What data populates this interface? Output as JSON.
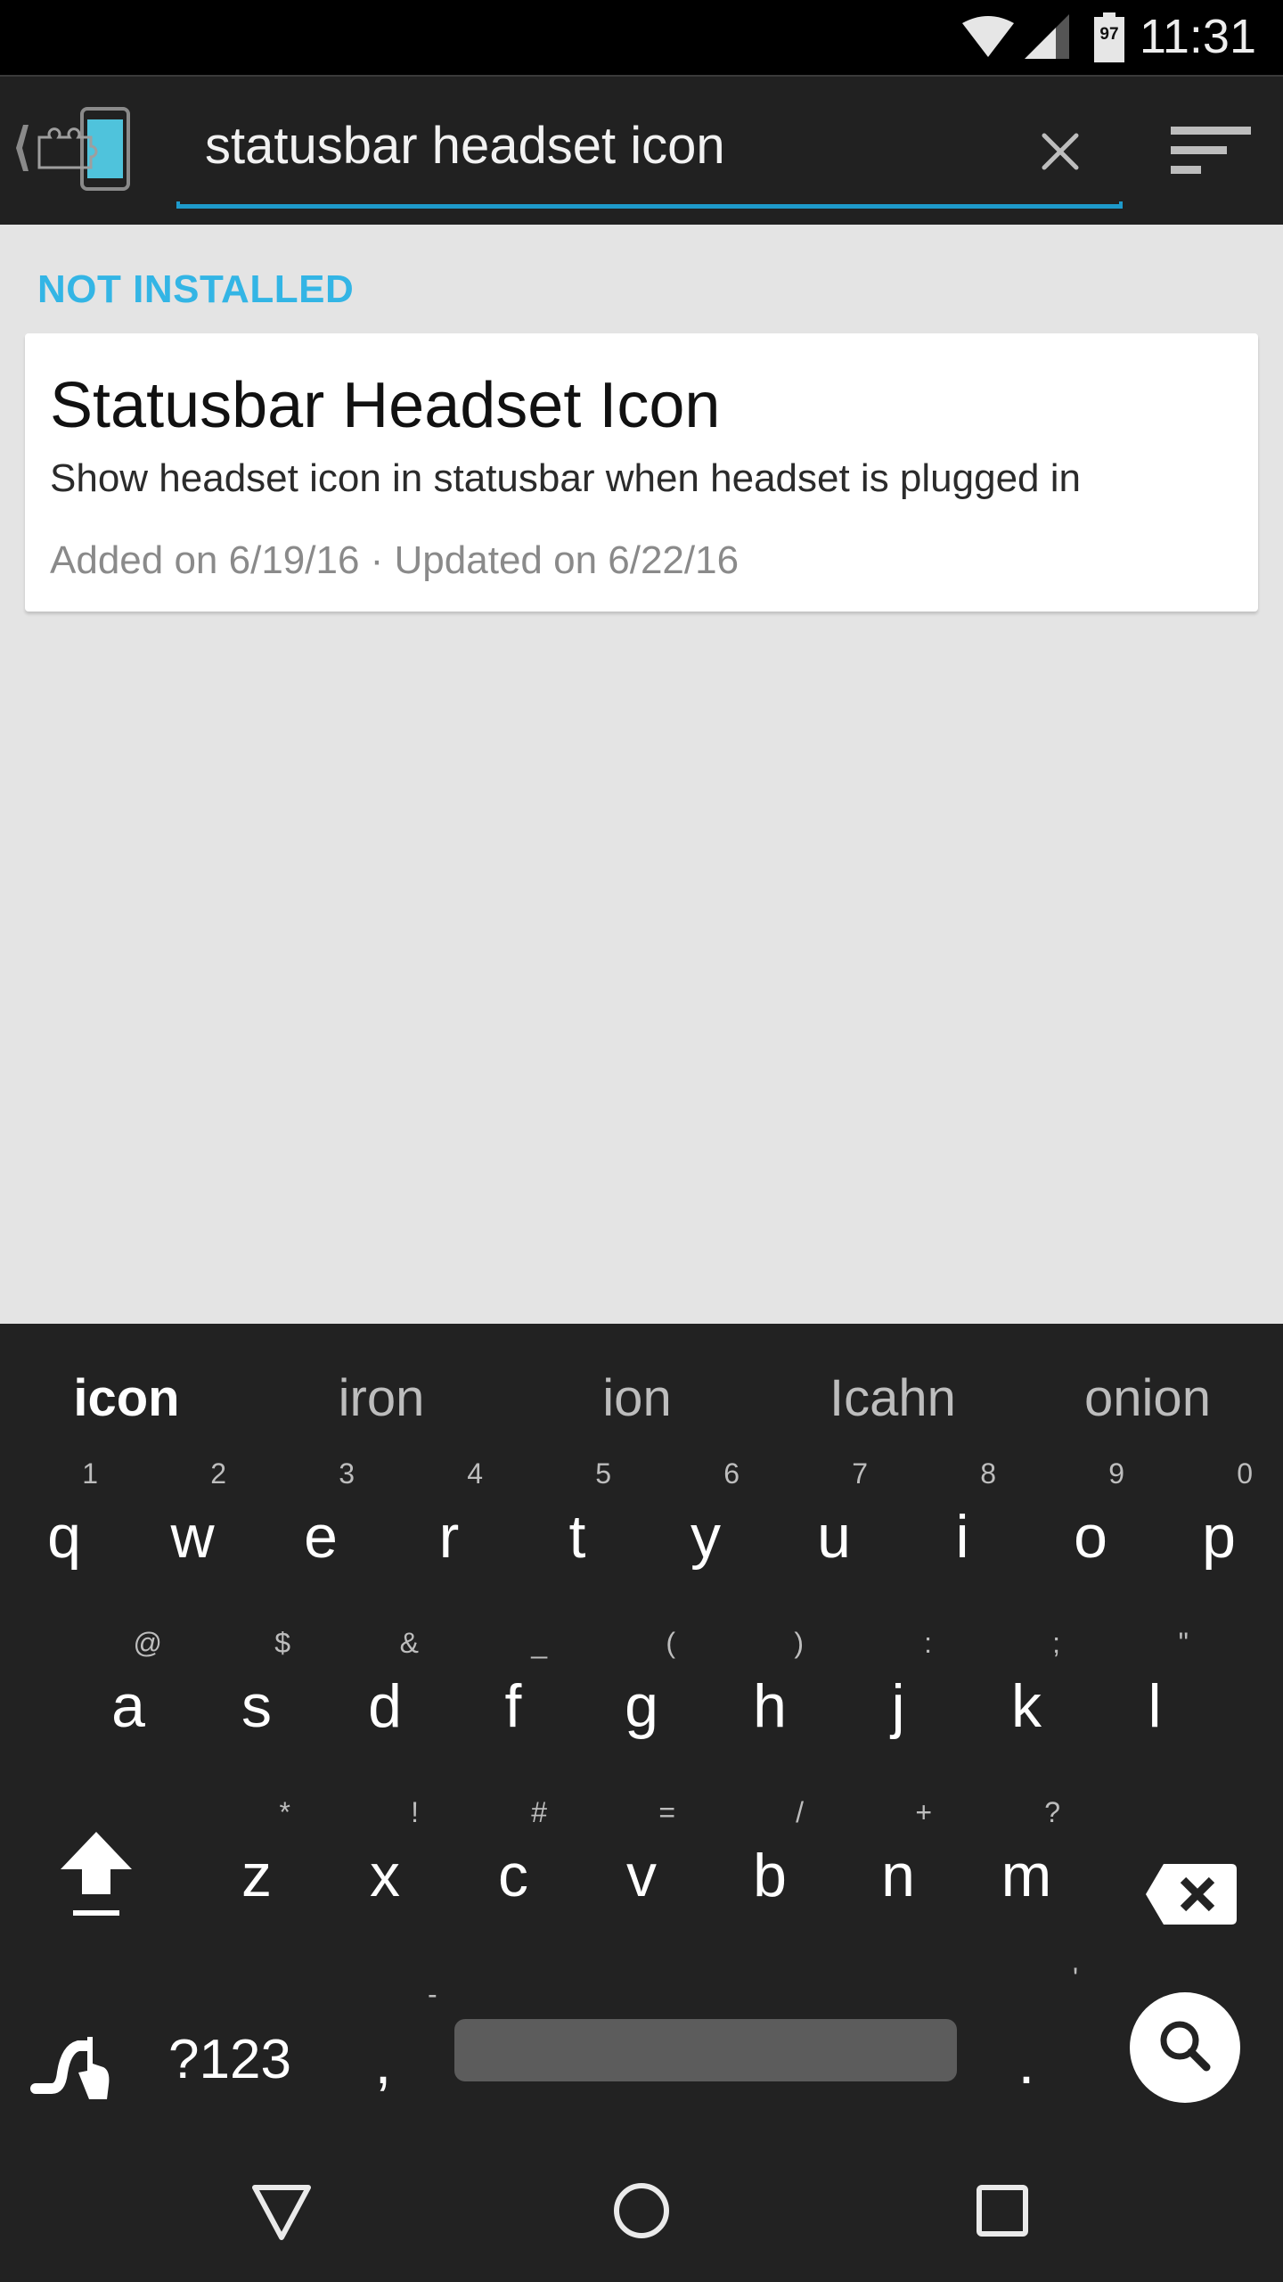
{
  "status_bar": {
    "time": "11:31",
    "battery_level": "97",
    "icons": [
      "wifi-icon",
      "signal-icon",
      "battery-icon"
    ]
  },
  "app_bar": {
    "logo_icon": "xposed-installer-icon",
    "back_icon": "chevron-left-icon",
    "search_value": "statusbar headset icon",
    "clear_icon": "close-icon",
    "sort_icon": "sort-icon"
  },
  "content": {
    "section_header": "NOT INSTALLED",
    "accent_color": "#33b5e5",
    "modules": [
      {
        "title": "Statusbar Headset Icon",
        "description": "Show headset icon in statusbar when headset is plugged in",
        "meta": "Added on 6/19/16 · Updated on 6/22/16"
      }
    ]
  },
  "keyboard": {
    "suggestions": [
      "icon",
      "iron",
      "ion",
      "Icahn",
      "onion"
    ],
    "row1": [
      {
        "key": "q",
        "hint": "1"
      },
      {
        "key": "w",
        "hint": "2"
      },
      {
        "key": "e",
        "hint": "3"
      },
      {
        "key": "r",
        "hint": "4"
      },
      {
        "key": "t",
        "hint": "5"
      },
      {
        "key": "y",
        "hint": "6"
      },
      {
        "key": "u",
        "hint": "7"
      },
      {
        "key": "i",
        "hint": "8"
      },
      {
        "key": "o",
        "hint": "9"
      },
      {
        "key": "p",
        "hint": "0"
      }
    ],
    "row2": [
      {
        "key": "a",
        "hint": "@"
      },
      {
        "key": "s",
        "hint": "$"
      },
      {
        "key": "d",
        "hint": "&"
      },
      {
        "key": "f",
        "hint": "_"
      },
      {
        "key": "g",
        "hint": "("
      },
      {
        "key": "h",
        "hint": ")"
      },
      {
        "key": "j",
        "hint": ":"
      },
      {
        "key": "k",
        "hint": ";"
      },
      {
        "key": "l",
        "hint": "\""
      }
    ],
    "row3": [
      {
        "key": "z",
        "hint": "*"
      },
      {
        "key": "x",
        "hint": "!"
      },
      {
        "key": "c",
        "hint": "#"
      },
      {
        "key": "v",
        "hint": "="
      },
      {
        "key": "b",
        "hint": "/"
      },
      {
        "key": "n",
        "hint": "+"
      },
      {
        "key": "m",
        "hint": "?"
      }
    ],
    "symbols_label": "?123",
    "comma": ",",
    "comma_hint": "-",
    "period": ".",
    "period_hint": "'",
    "shift_icon": "shift-icon",
    "backspace_icon": "backspace-icon",
    "gesture_icon": "gesture-typing-icon",
    "search_icon": "search-icon"
  },
  "nav_bar": {
    "back_icon": "back-triangle-icon",
    "home_icon": "home-circle-icon",
    "recents_icon": "recents-square-icon"
  }
}
